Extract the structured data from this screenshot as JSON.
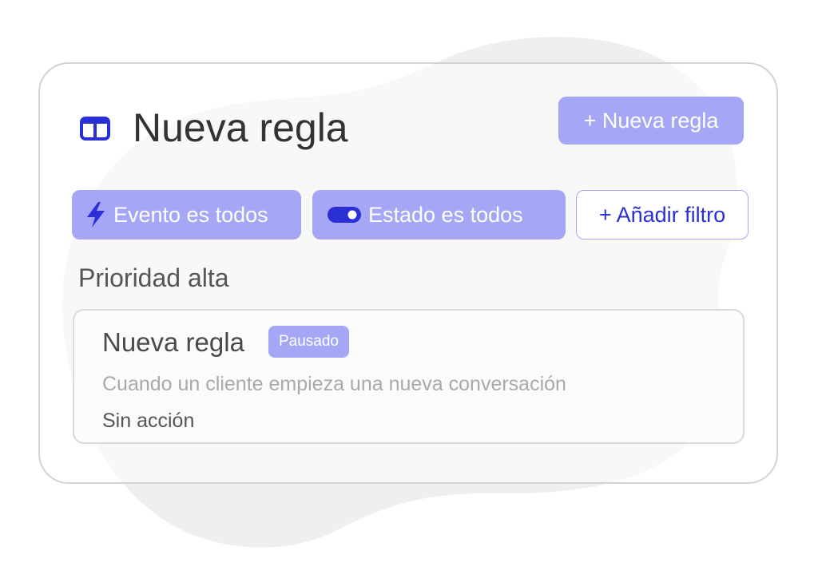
{
  "header": {
    "icon": "columns-icon",
    "title": "Nueva regla",
    "new_rule_button": "+ Nueva regla"
  },
  "filters": {
    "event": {
      "icon": "lightning-icon",
      "label": "Evento es todos"
    },
    "state": {
      "icon": "toggle-icon",
      "label": "Estado es todos"
    },
    "add": "+ Añadir filtro"
  },
  "section": {
    "label": "Prioridad alta"
  },
  "rule": {
    "name": "Nueva regla",
    "badge": "Pausado",
    "description": "Cuando un cliente empieza una nueva conversación",
    "action": "Sin acción"
  },
  "colors": {
    "accent": "#a5a6f6",
    "accent_dark": "#2b2fd6",
    "blob": "#efefef",
    "border": "#d3d3d3"
  }
}
